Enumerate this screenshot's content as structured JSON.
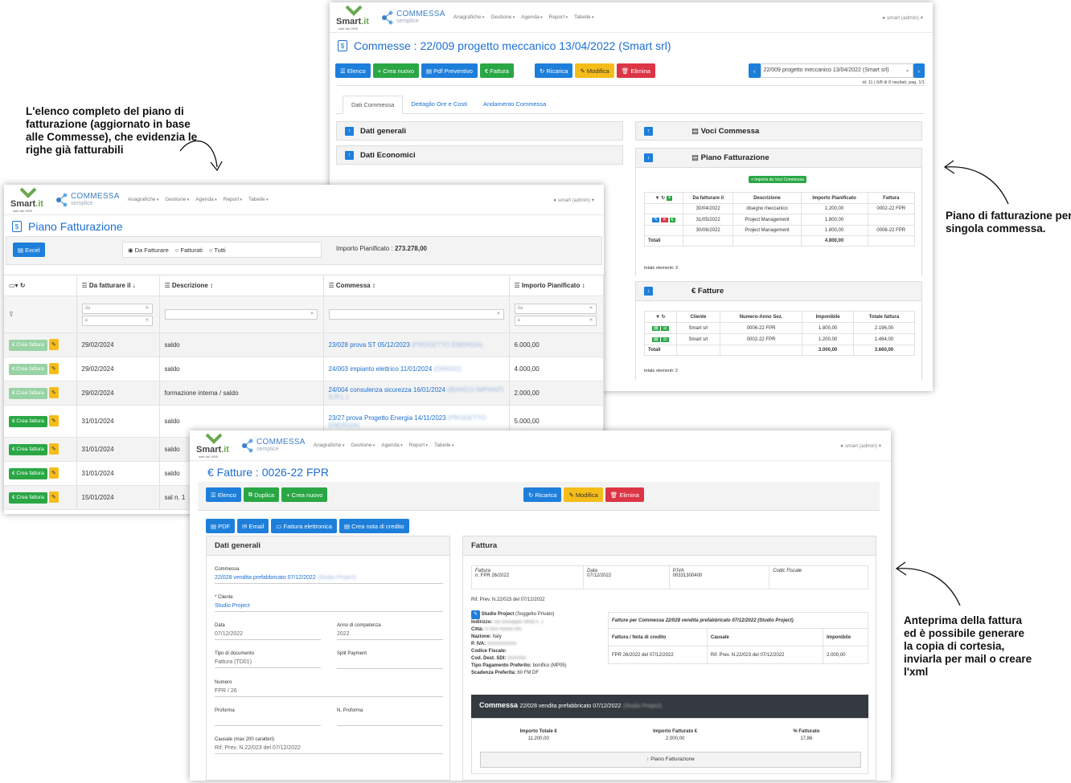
{
  "brand": {
    "name": "Smart",
    "name_suffix": ".it",
    "tagline": "web dal 1995",
    "product": "COMMESSA",
    "product_sub": "semplice"
  },
  "menu": [
    "Anagrafiche",
    "Gestione",
    "Agenda",
    "Report",
    "Tabelle"
  ],
  "user": "smart (admin)",
  "notes": {
    "left": "L'elenco completo del piano di fatturazione (aggiornato in base alle Commesse), che evidenzia le righe già fatturabili",
    "right_top": "Piano di fatturazione per singola commessa.",
    "right_bottom": "Anteprima della fattura ed è possibile generare la copia di cortesia, inviarla per mail o creare l'xml"
  },
  "commessa_win": {
    "title": "Commesse : 22/009 progetto meccanico 13/04/2022 (Smart srl)",
    "buttons": {
      "elenco": "Elenco",
      "crea": "+ Crea nuovo",
      "pdf": "Pdf Preventivo",
      "fattura": "€ Fattura",
      "ricarica": "Ricarica",
      "modifica": "Modifica",
      "elimina": "Elimina"
    },
    "selector": "22/009 progetto meccanico 13/04/2022 (Smart srl)",
    "paging": "id: 11 | 6/8 di 8 risultati, pag. 1/1",
    "tabs": [
      "Dati Commessa",
      "Dettaglio Ore e Costi",
      "Andamento Commessa"
    ],
    "sections": {
      "dati_generali": "Dati generali",
      "dati_economici": "Dati Economici",
      "voci": "Voci Commessa",
      "piano": "Piano Fatturazione",
      "fatture": "€ Fatture"
    },
    "import_btn": "+ Importa da Voci Commessa",
    "piano_headers": [
      "Da fatturare il",
      "Descrizione",
      "Importo Pianificato",
      "Fattura"
    ],
    "piano_rows": [
      {
        "date": "30/04/2022",
        "desc": "disegno meccanico",
        "amount": "1.200,00",
        "inv": "0002-22 FPR"
      },
      {
        "date": "31/05/2022",
        "desc": "Project Management",
        "amount": "1.800,00",
        "inv": ""
      },
      {
        "date": "30/06/2022",
        "desc": "Project Management",
        "amount": "1.800,00",
        "inv": "0006-22 FPR"
      }
    ],
    "piano_total_label": "Totali",
    "piano_total": "4.800,00",
    "piano_count": "totale elementi: 3",
    "fatt_headers": [
      "Cliente",
      "Numero-Anno Sez.",
      "Imponibile",
      "Totale fattura"
    ],
    "fatt_rows": [
      {
        "client": "Smart srl",
        "num": "0006-22 FPR",
        "imp": "1.800,00",
        "tot": "2.196,00"
      },
      {
        "client": "Smart srl",
        "num": "0002-22 FPR",
        "imp": "1.200,00",
        "tot": "1.464,00"
      }
    ],
    "fatt_total_label": "Totali",
    "fatt_imp_total": "3.000,00",
    "fatt_tot_total": "3.660,00",
    "fatt_count": "totale elementi: 2"
  },
  "piano_win": {
    "title": "Piano Fatturazione",
    "excel": "Excel",
    "radios": [
      "Da Fatturare",
      "Fatturati",
      "Tutti"
    ],
    "importo_label": "Importo Pianificato :",
    "importo_value": "273.278,00",
    "headers": [
      "Da fatturare il",
      "Descrizione",
      "Commessa",
      "Importo Pianificato"
    ],
    "da": "da",
    "a": "a",
    "crea_label": "€ Crea fattura",
    "rows": [
      {
        "date": "29/02/2024",
        "desc": "saldo",
        "comm": "23/028 prova ST 05/12/2023",
        "blur": "(PROGETTO ENERGIA)",
        "amount": "6.000,00",
        "dim": true
      },
      {
        "date": "29/02/2024",
        "desc": "saldo",
        "comm": "24/003 impianto elettrico 11/01/2024",
        "blur": "(GRIGIO)",
        "amount": "4.000,00",
        "dim": true
      },
      {
        "date": "29/02/2024",
        "desc": "formazione interna / saldo",
        "comm": "24/004 consulenza sicurezza 16/01/2024",
        "blur": "(BIANCO IMPIANTI S.R.L.)",
        "amount": "2.000,00",
        "dim": true
      },
      {
        "date": "31/01/2024",
        "desc": "saldo",
        "comm": "23/27 prova Progetto Energia 14/11/2023",
        "blur": "(PROGETTO ENERGIA)",
        "amount": "5.000,00",
        "dim": false
      },
      {
        "date": "31/01/2024",
        "desc": "saldo",
        "comm": "",
        "blur": "",
        "amount": "",
        "dim": false
      },
      {
        "date": "31/01/2024",
        "desc": "saldo",
        "comm": "",
        "blur": "",
        "amount": "",
        "dim": false
      },
      {
        "date": "15/01/2024",
        "desc": "sal n. 1",
        "comm": "",
        "blur": "",
        "amount": "",
        "dim": false
      }
    ]
  },
  "fattura_win": {
    "title": "€  Fatture : 0026-22 FPR",
    "buttons": {
      "elenco": "Elenco",
      "duplica": "Duplica",
      "crea": "+ Crea nuovo",
      "ricarica": "Ricarica",
      "modifica": "Modifica",
      "elimina": "Elimina",
      "pdf": "PDF",
      "email": "Email",
      "fe": "Fattura elettronica",
      "nota": "Crea nota di credito"
    },
    "dati_title": "Dati generali",
    "fattura_title": "Fattura",
    "fields": {
      "commessa_l": "Commessa",
      "commessa_v": "22/028 vendita prefabbricato 07/12/2022",
      "commessa_b": "(Studio Project)",
      "cliente_l": "* Cliente",
      "cliente_v": "Studio Project",
      "data_l": "Data",
      "data_v": "07/12/2022",
      "anno_l": "Anno di competenza",
      "anno_v": "2022",
      "tipo_l": "Tipo di documento",
      "tipo_v": "Fattura (TD01)",
      "split_l": "Split Payment",
      "numero_l": "Numero",
      "numero_v": "FPR / 26",
      "proforma_l": "Proforma",
      "nproforma_l": "N. Proforma",
      "causale_l": "Causale (max 200 caratteri)",
      "causale_v": "Rif. Prev. N.22/023 del 07/12/2022"
    },
    "head": {
      "fattura_l": "Fattura",
      "fattura_v": "n. FPR 26/2022",
      "data_l": "Data",
      "data_v": "07/12/2022",
      "piva_l": "P.IVA",
      "piva_v": "00331300400",
      "cf_l": "Codic Fiscale"
    },
    "rif": "Rif. Prev. N.22/023 del 07/12/2022",
    "cliente": {
      "name": "Studio Project",
      "type": "(Soggetto Privato)",
      "lines": [
        [
          "Indirizzo:",
          "via Giuseppe Verdi n. 1"
        ],
        [
          "Città:",
          "47900 Rimini RN"
        ],
        [
          "Nazione:",
          "Italy"
        ],
        [
          "P. IVA:",
          "00000000000"
        ],
        [
          "Codice Fiscale:",
          ""
        ],
        [
          "Cod. Dest. SDI:",
          "0000000"
        ],
        [
          "Tipo Pagamento Preferito:",
          "bonifico (MP05)"
        ],
        [
          "Scadenza Preferita:",
          "60 FM DF"
        ]
      ]
    },
    "fpc": {
      "title": "Fatture per Commessa 22/028 vendita prefabbricato 07/12/2022 (Studio Project)",
      "headers": [
        "Fattura / Nota di credito",
        "Causale",
        "Imponibile"
      ],
      "row": [
        "FPR 26/2022 del 07/12/2022",
        "Rif. Prev. N.22/023 del 07/12/2022",
        "2.000,00"
      ]
    },
    "commessa_bar": {
      "label": "Commessa",
      "text": "22/028 vendita prefabbricato 07/12/2022",
      "blur": "(Studio Project)"
    },
    "stats": [
      {
        "l": "Importo Totale €",
        "v": "11.200,00"
      },
      {
        "l": "Importo Fatturato €",
        "v": "2.000,00"
      },
      {
        "l": "% Fatturato",
        "v": "17,86"
      }
    ],
    "piano_btn": "↑ Piano Fatturazione"
  }
}
